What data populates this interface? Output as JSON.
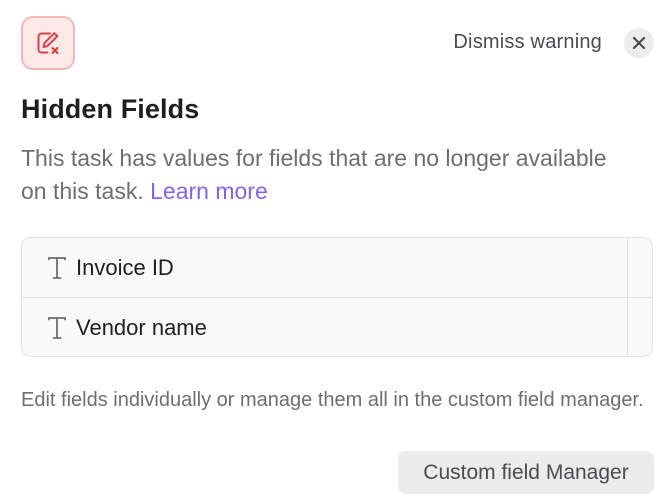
{
  "header": {
    "icon": "edit-field-error-icon",
    "dismiss_label": "Dismiss warning",
    "close_icon": "close-icon"
  },
  "panel": {
    "title": "Hidden Fields",
    "description": "This task has values for fields that are no longer available on this task.",
    "learn_more_label": "Learn more"
  },
  "hidden_fields": [
    {
      "icon": "text-type-icon",
      "name": "Invoice ID"
    },
    {
      "icon": "text-type-icon",
      "name": "Vendor name"
    }
  ],
  "footer": {
    "text": "Edit fields individually or manage them all in the custom field manager.",
    "button_label": "Custom field Manager"
  },
  "colors": {
    "accent_link": "#7b68ee",
    "warning_icon": "#d9424b",
    "warning_bg": "#fde8e8"
  }
}
